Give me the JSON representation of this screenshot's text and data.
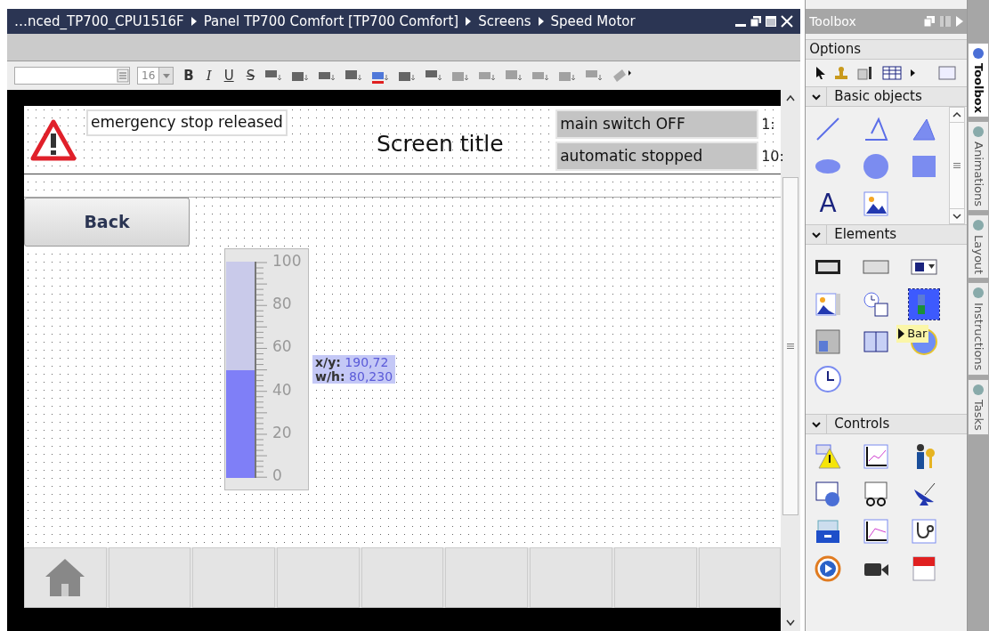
{
  "editor": {
    "breadcrumb": [
      "…nced_TP700_CPU1516F",
      "Panel TP700 Comfort [TP700 Comfort]",
      "Screens",
      "Speed Motor"
    ],
    "toolbar": {
      "font_size": "16",
      "text_styles": [
        "B",
        "I",
        "U",
        "S"
      ]
    },
    "screen": {
      "alarm_text": "emergency stop released",
      "title": "Screen title",
      "status": [
        {
          "label": "main switch OFF",
          "side": "1:"
        },
        {
          "label": "automatic stopped",
          "side": "10:"
        }
      ],
      "back_button": "Back",
      "bar": {
        "level": 0.5,
        "scale": [
          "100",
          "80",
          "60",
          "40",
          "20",
          "0"
        ]
      },
      "tooltip": [
        {
          "label": "x/y:",
          "value": "190,72"
        },
        {
          "label": "w/h:",
          "value": "80,230"
        }
      ]
    }
  },
  "toolbox": {
    "title": "Toolbox",
    "options_title": "Options",
    "sections": [
      {
        "title": "Basic objects",
        "expanded": true,
        "text_tool": "A"
      },
      {
        "title": "Elements",
        "expanded": true
      },
      {
        "title": "Controls",
        "expanded": true
      }
    ],
    "elements": [
      {
        "selected": false
      },
      {
        "selected": false
      },
      {
        "selected": false
      },
      {
        "selected": false
      },
      {
        "selected": false
      },
      {
        "selected": true
      },
      {
        "selected": false
      },
      {
        "selected": false
      },
      {
        "selected": false
      },
      {
        "selected": false
      }
    ],
    "hover_label": "Bar"
  },
  "side_tabs": [
    {
      "label": "Toolbox",
      "selected": true
    },
    {
      "label": "Animations",
      "selected": false
    },
    {
      "label": "Layout",
      "selected": false
    },
    {
      "label": "Instructions",
      "selected": false
    },
    {
      "label": "Tasks",
      "selected": false
    }
  ]
}
